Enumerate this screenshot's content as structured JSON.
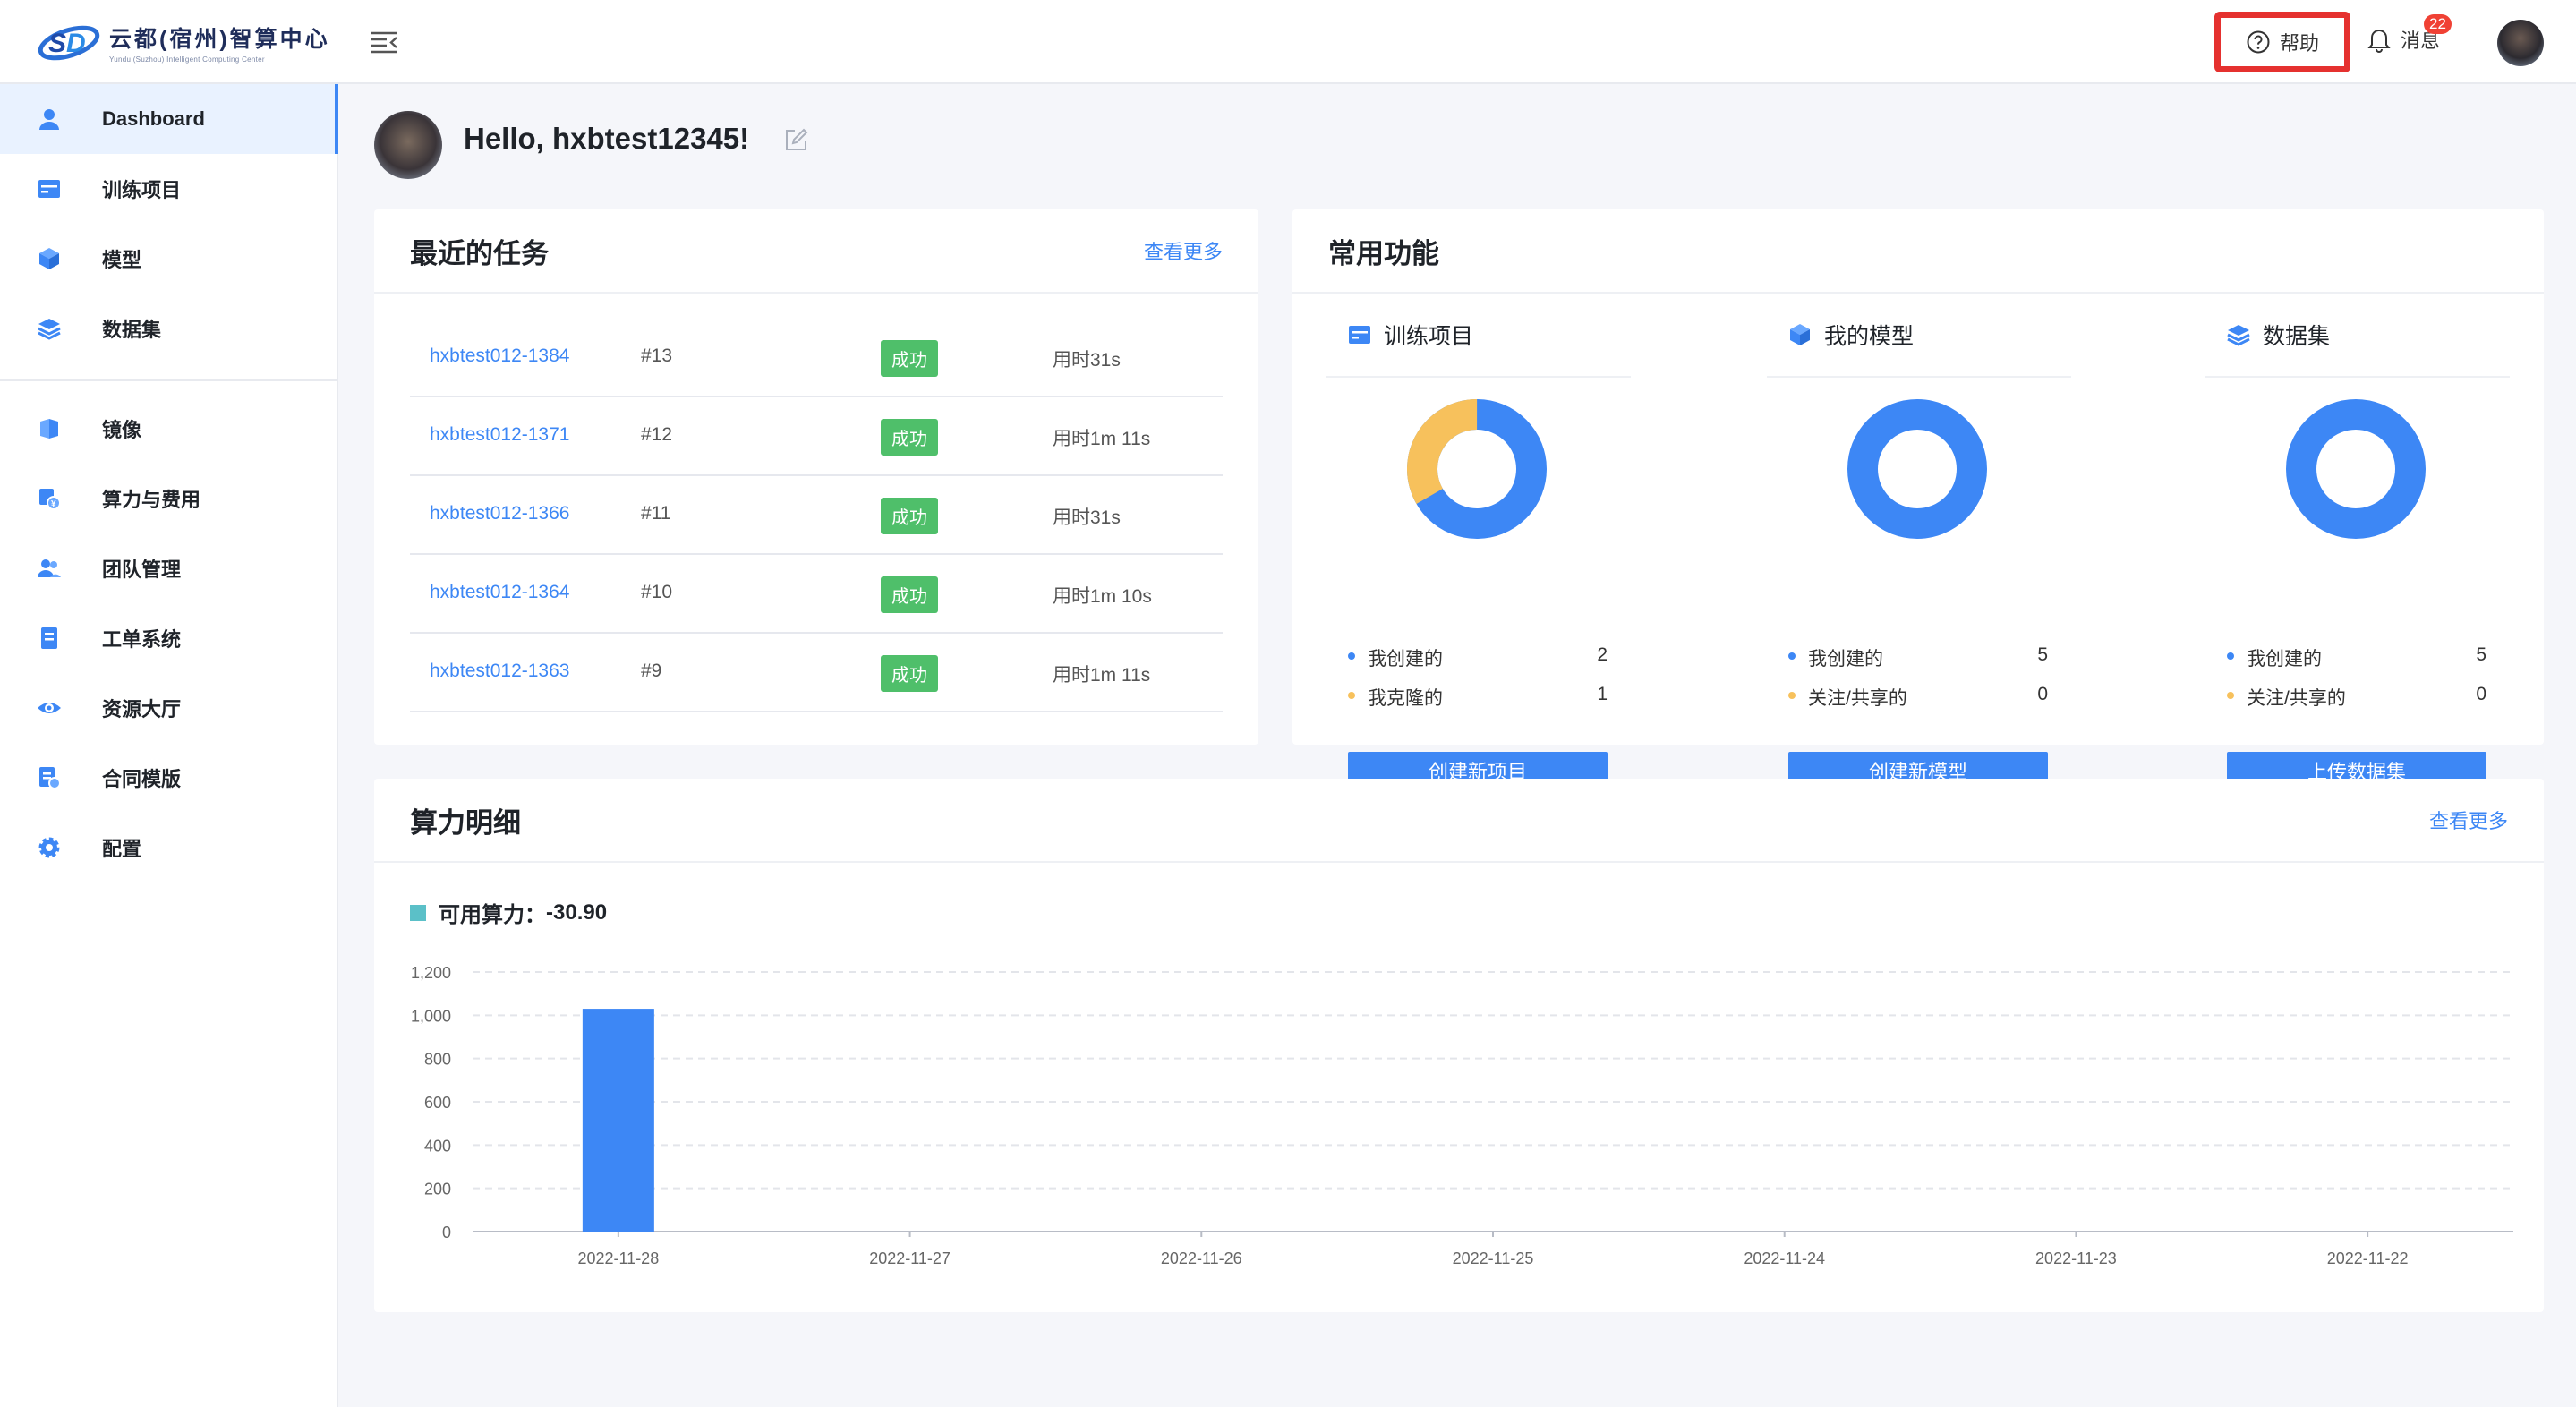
{
  "app": {
    "logo_title": "云都(宿州)智算中心",
    "logo_subtitle": "Yundu (Suzhou) Intelligent Computing Center"
  },
  "topbar": {
    "help_label": "帮助",
    "messages_label": "消息",
    "messages_badge": "22"
  },
  "sidebar": {
    "items": [
      {
        "label": "Dashboard",
        "icon": "user-icon",
        "active": true
      },
      {
        "label": "训练项目",
        "icon": "project-icon"
      },
      {
        "label": "模型",
        "icon": "cube-icon"
      },
      {
        "label": "数据集",
        "icon": "layers-icon"
      },
      {
        "label": "镜像",
        "icon": "image-icon"
      },
      {
        "label": "算力与费用",
        "icon": "billing-icon"
      },
      {
        "label": "团队管理",
        "icon": "team-icon"
      },
      {
        "label": "工单系统",
        "icon": "ticket-icon"
      },
      {
        "label": "资源大厅",
        "icon": "eye-icon"
      },
      {
        "label": "合同模版",
        "icon": "contract-icon"
      },
      {
        "label": "配置",
        "icon": "gear-icon"
      }
    ]
  },
  "greeting": {
    "text": "Hello, hxbtest12345!"
  },
  "tasks": {
    "title": "最近的任务",
    "more": "查看更多",
    "rows": [
      {
        "name": "hxbtest012-1384",
        "num": "#13",
        "status": "成功",
        "time": "用时31s"
      },
      {
        "name": "hxbtest012-1371",
        "num": "#12",
        "status": "成功",
        "time": "用时1m 11s"
      },
      {
        "name": "hxbtest012-1366",
        "num": "#11",
        "status": "成功",
        "time": "用时31s"
      },
      {
        "name": "hxbtest012-1364",
        "num": "#10",
        "status": "成功",
        "time": "用时1m 10s"
      },
      {
        "name": "hxbtest012-1363",
        "num": "#9",
        "status": "成功",
        "time": "用时1m 11s"
      }
    ]
  },
  "functions": {
    "title": "常用功能",
    "colors": {
      "primary": "#3d87f5",
      "secondary": "#f7c15c"
    },
    "columns": [
      {
        "title": "训练项目",
        "icon": "project-icon",
        "legend": [
          {
            "label": "我创建的",
            "value": "2"
          },
          {
            "label": "我克隆的",
            "value": "1"
          }
        ],
        "button": "创建新项目"
      },
      {
        "title": "我的模型",
        "icon": "cube-icon",
        "legend": [
          {
            "label": "我创建的",
            "value": "5"
          },
          {
            "label": "关注/共享的",
            "value": "0"
          }
        ],
        "button": "创建新模型"
      },
      {
        "title": "数据集",
        "icon": "layers-icon",
        "legend": [
          {
            "label": "我创建的",
            "value": "5"
          },
          {
            "label": "关注/共享的",
            "value": "0"
          }
        ],
        "button": "上传数据集"
      }
    ]
  },
  "compute": {
    "title": "算力明细",
    "more": "查看更多",
    "available_label": "可用算力：",
    "available_value": "-30.90"
  },
  "chart_data": {
    "type": "bar",
    "categories": [
      "2022-11-28",
      "2022-11-27",
      "2022-11-26",
      "2022-11-25",
      "2022-11-24",
      "2022-11-23",
      "2022-11-22"
    ],
    "values": [
      1030,
      0,
      0,
      0,
      0,
      0,
      0
    ],
    "ylim": [
      0,
      1200
    ],
    "yticks": [
      "0",
      "200",
      "400",
      "600",
      "800",
      "1,000",
      "1,200"
    ],
    "color": "#3d87f5",
    "grid": true
  }
}
